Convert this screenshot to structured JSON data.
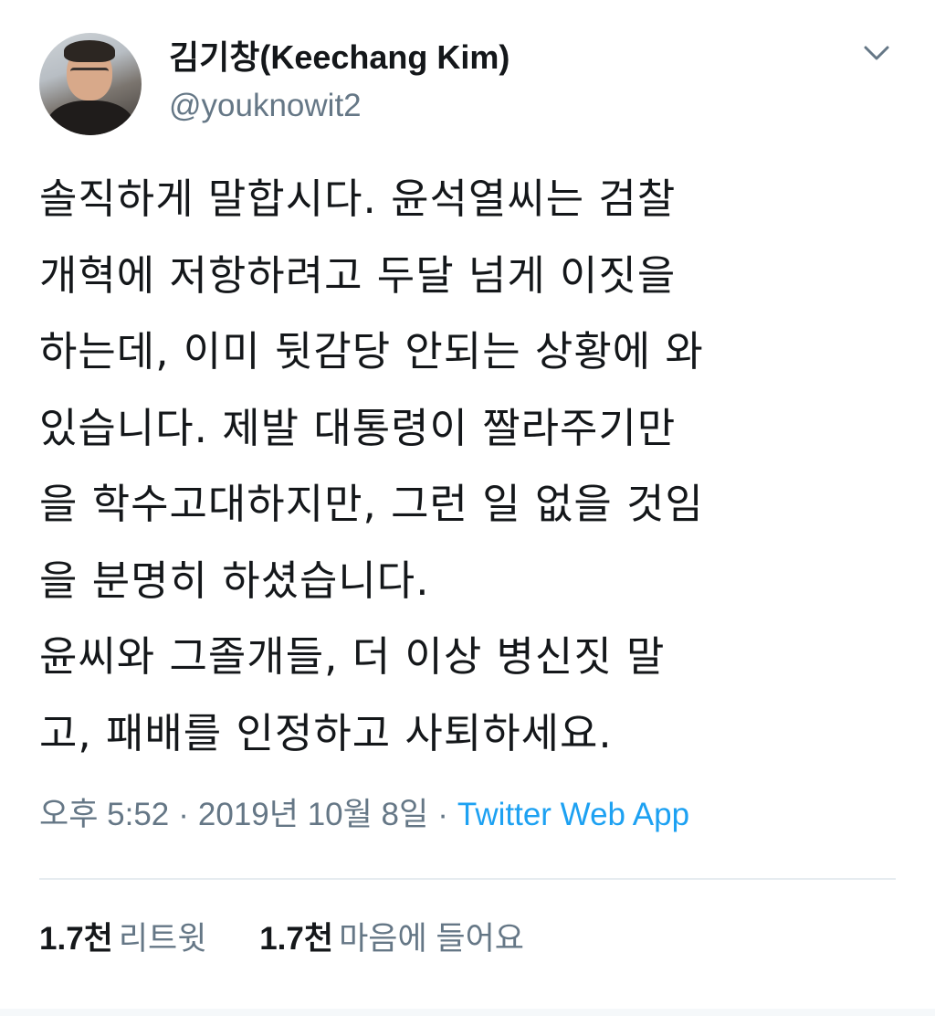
{
  "author": {
    "name": "김기창(Keechang Kim)",
    "handle": "@youknowit2",
    "avatar_icon": "profile-photo"
  },
  "menu": {
    "icon": "chevron-down-icon"
  },
  "tweet": {
    "lines": [
      "솔직하게 말합시다. 윤석열씨는 검찰",
      "개혁에 저항하려고 두달 넘게 이짓을",
      "하는데, 이미 뒷감당 안되는 상황에 와",
      "있습니다. 제발 대통령이 짤라주기만",
      "을 학수고대하지만, 그런 일 없을 것임",
      "을 분명히 하셨습니다.",
      "윤씨와 그졸개들, 더 이상 병신짓 말",
      "고, 패배를 인정하고 사퇴하세요."
    ]
  },
  "meta": {
    "time": "오후 5:52",
    "separator": "·",
    "date": "2019년 10월 8일",
    "source": "Twitter Web App"
  },
  "stats": {
    "retweets": {
      "count": "1.7천",
      "label": "리트윗"
    },
    "likes": {
      "count": "1.7천",
      "label": "마음에 들어요"
    }
  },
  "colors": {
    "text": "#14171a",
    "secondary": "#657786",
    "link": "#1da1f2",
    "divider": "#e6ecf0"
  }
}
